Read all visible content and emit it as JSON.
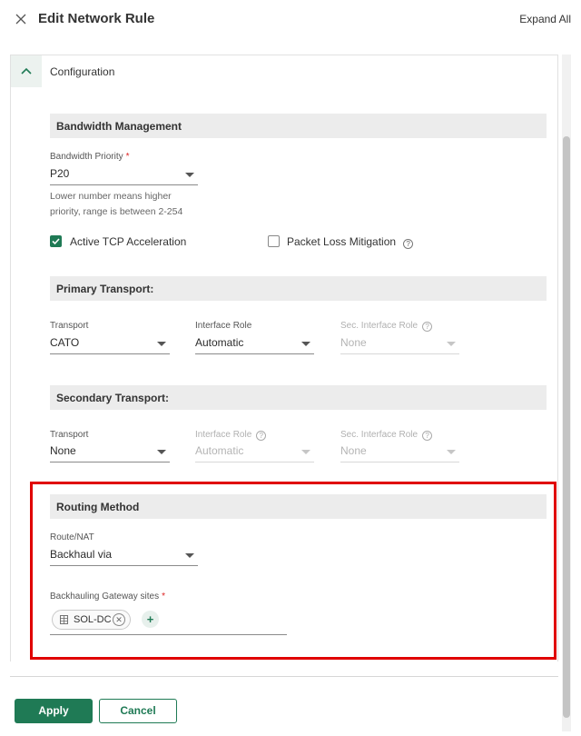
{
  "header": {
    "title": "Edit Network Rule",
    "expand_all": "Expand All"
  },
  "panel": {
    "title": "Configuration"
  },
  "bandwidth": {
    "section_title": "Bandwidth Management",
    "priority_label": "Bandwidth Priority",
    "required_mark": "*",
    "priority_value": "P20",
    "hint_line1": "Lower number means higher",
    "hint_line2": "priority, range is between 2-254",
    "tcp_accel_label": "Active TCP Acceleration",
    "tcp_accel_checked": true,
    "packet_loss_label": "Packet Loss Mitigation",
    "packet_loss_checked": false
  },
  "primary": {
    "section_title": "Primary Transport:",
    "transport_label": "Transport",
    "transport_value": "CATO",
    "role_label": "Interface Role",
    "role_value": "Automatic",
    "sec_role_label": "Sec. Interface Role",
    "sec_role_value": "None"
  },
  "secondary": {
    "section_title": "Secondary Transport:",
    "transport_label": "Transport",
    "transport_value": "None",
    "role_label": "Interface Role",
    "role_value": "Automatic",
    "sec_role_label": "Sec. Interface Role",
    "sec_role_value": "None"
  },
  "routing": {
    "section_title": "Routing Method",
    "route_label": "Route/NAT",
    "route_value": "Backhaul via",
    "gateway_label": "Backhauling Gateway sites",
    "required_mark": "*",
    "chips": [
      {
        "label": "SOL-DC"
      }
    ],
    "add_symbol": "+"
  },
  "footer": {
    "apply_label": "Apply",
    "cancel_label": "Cancel"
  },
  "colors": {
    "accent": "#1f7a55",
    "highlight": "#e00000",
    "section_bg": "#ececec"
  },
  "icons": {
    "close": "close-icon",
    "collapse": "chevron-up-icon",
    "help": "help-circle-icon",
    "grid": "grid-icon",
    "remove": "close-circle-icon"
  }
}
